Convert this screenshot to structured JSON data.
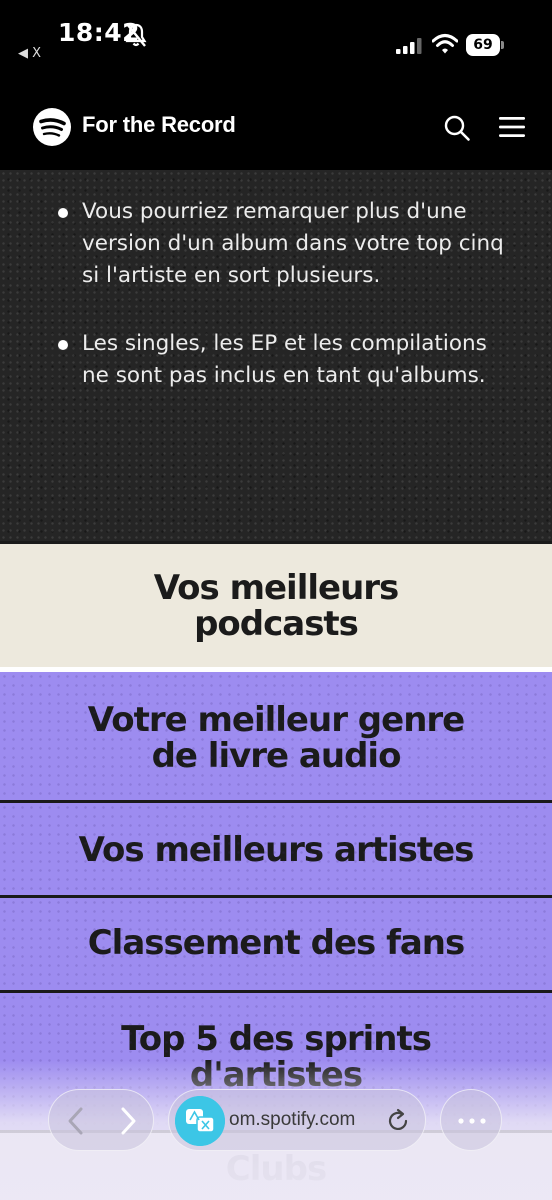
{
  "status_bar": {
    "time": "18:42",
    "back_app_label": "◀ X",
    "battery": "69"
  },
  "header": {
    "title": "For the Record"
  },
  "info": {
    "bullets": [
      "Vous pourriez remarquer plus d'une version d'un album dans votre top cinq si l'artiste en sort plusieurs.",
      "Les singles, les EP et les compilations ne sont pas inclus en tant qu'albums."
    ]
  },
  "sections": {
    "podcasts_line1": "Vos meilleurs",
    "podcasts_line2": "podcasts",
    "genre_line1": "Votre meilleur genre",
    "genre_line2": "de livre audio",
    "artists": "Vos meilleurs artistes",
    "fans": "Classement des fans",
    "sprints_line1": "Top 5 des sprints",
    "sprints_line2": "d'artistes",
    "clubs": "Clubs"
  },
  "browser": {
    "url": "om.spotify.com"
  },
  "colors": {
    "purple": "#9d8cf0",
    "cream": "#ede9dd",
    "dark": "#252525",
    "translate_accent": "#3cc6e6"
  },
  "icons": [
    "bell-slash-icon",
    "signal-icon",
    "wifi-icon",
    "battery-icon",
    "spotify-logo",
    "search-icon",
    "menu-icon",
    "back-arrow-icon",
    "forward-arrow-icon",
    "translate-icon",
    "reload-icon",
    "more-icon"
  ]
}
